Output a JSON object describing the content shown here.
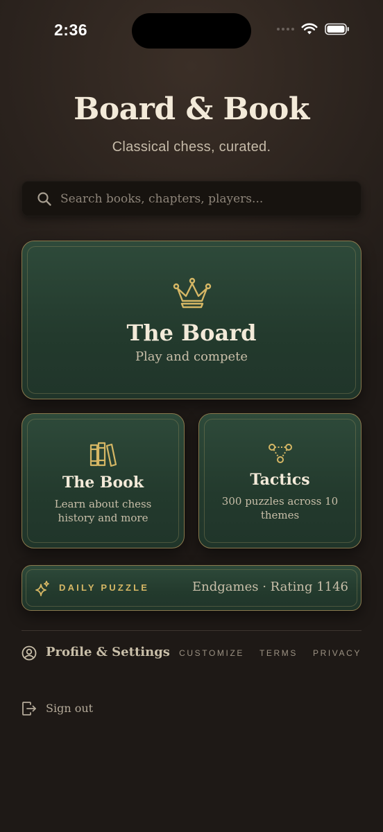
{
  "status_bar": {
    "time": "2:36",
    "icons": [
      "cellular-signal-icon",
      "wifi-icon",
      "battery-icon"
    ]
  },
  "header": {
    "title": "Board & Book",
    "subtitle": "Classical chess, curated."
  },
  "search": {
    "placeholder": "Search books, chapters, players...",
    "value": ""
  },
  "cards": {
    "board": {
      "icon": "crown-icon",
      "title": "The Board",
      "subtitle": "Play and compete"
    },
    "book": {
      "icon": "books-icon",
      "title": "The Book",
      "subtitle": "Learn about chess history and more"
    },
    "tactics": {
      "icon": "node-graph-icon",
      "title": "Tactics",
      "subtitle": "300 puzzles across 10 themes"
    }
  },
  "daily_puzzle": {
    "icon": "sparkle-icon",
    "label": "DAILY PUZZLE",
    "info": "Endgames · Rating 1146"
  },
  "footer": {
    "profile_icon": "profile-icon",
    "profile_label": "Profile & Settings",
    "links": [
      "CUSTOMIZE",
      "TERMS",
      "PRIVACY"
    ],
    "signout_icon": "signout-icon",
    "signout_label": "Sign out"
  },
  "colors": {
    "background": "#201a17",
    "card_green": "#2b4536",
    "gold_accent": "#d6b765",
    "cream_text": "#f3ead9"
  }
}
